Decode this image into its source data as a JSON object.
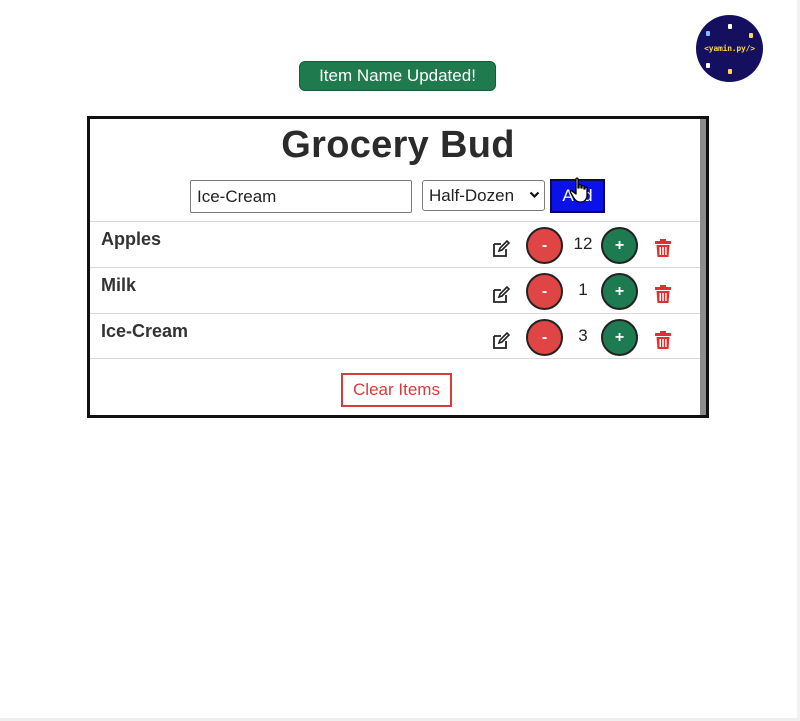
{
  "alert": {
    "text": "Item Name Updated!"
  },
  "title": "Grocery Bud",
  "form": {
    "item_value": "Ice-Cream",
    "quantity_selected": "Half-Dozen",
    "add_label": "Add"
  },
  "items": [
    {
      "name": "Apples",
      "count": "12",
      "minus": "-",
      "plus": "+"
    },
    {
      "name": "Milk",
      "count": "1",
      "minus": "-",
      "plus": "+"
    },
    {
      "name": "Ice-Cream",
      "count": "3",
      "minus": "-",
      "plus": "+"
    }
  ],
  "clear_label": "Clear Items",
  "watermark": {
    "text": "<yamin.py/>"
  },
  "colors": {
    "alert": "#1f7a4d",
    "add": "#0b12e8",
    "minus": "#e04545",
    "plus": "#1e7a50",
    "danger": "#d93b3b"
  },
  "icons": {
    "edit": "edit-icon",
    "delete": "trash-icon",
    "chevron": "chevron-down-icon",
    "cursor": "hand-cursor-icon"
  }
}
